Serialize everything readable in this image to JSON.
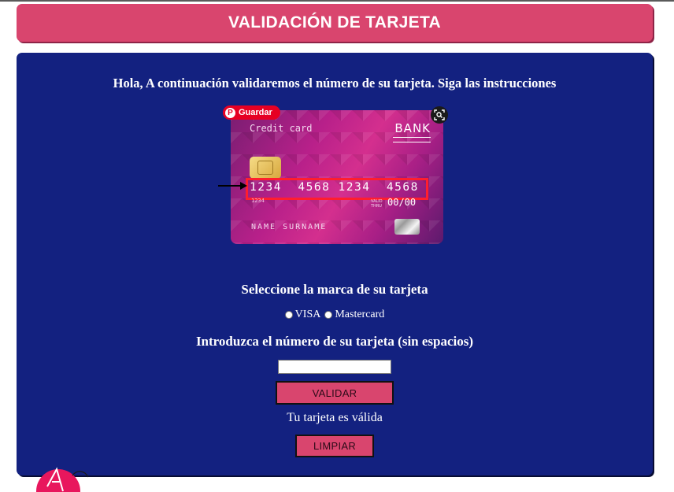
{
  "header": {
    "title": "VALIDACIÓN DE TARJETA"
  },
  "intro": {
    "text": "Hola, A continuación validaremos el número de su tarjeta. Siga las instrucciones"
  },
  "card_image": {
    "label": "Credit card",
    "bank": "BANK",
    "number": "1234  4568 1234  4568",
    "small_number": "1234",
    "valid_thru": "VALID THRU",
    "expiry": "00/00",
    "name": "NAME SURNAME",
    "save_label": "Guardar",
    "save_icon": "pinterest-icon",
    "lens_icon": "visual-search-icon"
  },
  "brand": {
    "title": "Seleccione la marca de su tarjeta",
    "options": [
      "VISA",
      "Mastercard"
    ]
  },
  "number_input": {
    "title": "Introduzca el número de su tarjeta (sin espacios)",
    "value": "",
    "placeholder": ""
  },
  "buttons": {
    "validar": "VALIDAR",
    "limpiar": "LIMPIAR"
  },
  "result": {
    "text": "Tu tarjeta es válida"
  },
  "colors": {
    "header": "#d9456e",
    "panel": "#132180",
    "button": "#d9456e"
  }
}
